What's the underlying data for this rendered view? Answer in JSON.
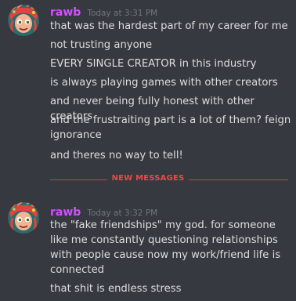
{
  "messages": [
    {
      "username": "rawb",
      "timestamp": "Today at 3:31 PM",
      "lines": [
        "that was the hardest part of my career for me",
        "not trusting anyone",
        "EVERY SINGLE CREATOR in this industry",
        "is always playing games with other creators",
        "and never being fully honest with other creators",
        "and the frustraiting part is a lot of them? feign ignorance",
        "and theres no way to tell!"
      ]
    },
    {
      "username": "rawb",
      "timestamp": "Today at 3:32 PM",
      "lines": [
        "the \"fake friendships\" my god. for someone like me constantly questioning relationships with people cause now my work/friend life is connected",
        "that shit is endless stress"
      ]
    }
  ],
  "divider": {
    "label": "NEW MESSAGES",
    "color": "#f04747"
  },
  "colors": {
    "background": "#36393f",
    "username": "#d14fff",
    "timestamp": "#72767d",
    "text": "#dcddde"
  }
}
